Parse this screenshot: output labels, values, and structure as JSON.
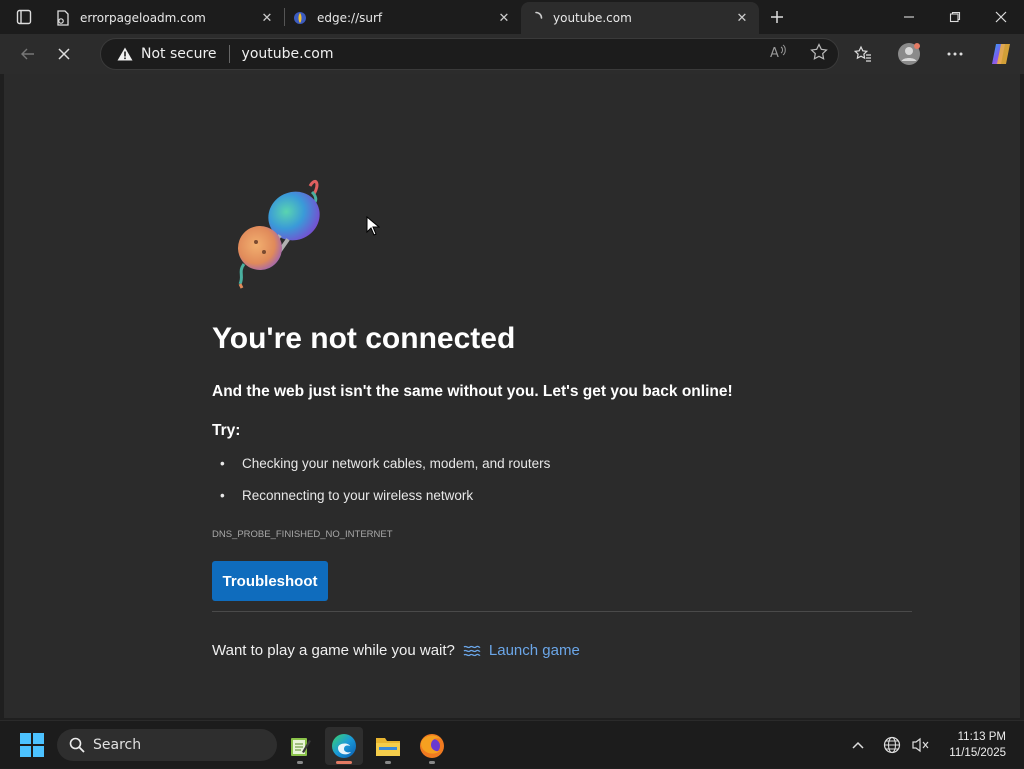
{
  "tabs": [
    {
      "title": "errorpageloadm.com",
      "icon": "document-icon"
    },
    {
      "title": "edge://surf",
      "icon": "surf-icon"
    },
    {
      "title": "youtube.com",
      "icon": "loading-spinner-icon",
      "active": true
    }
  ],
  "address_bar": {
    "security_label": "Not secure",
    "url": "youtube.com"
  },
  "error_page": {
    "title": "You're not connected",
    "subtitle": "And the web just isn't the same without you. Let's get you back online!",
    "try_label": "Try:",
    "suggestions": [
      "Checking your network cables, modem, and routers",
      "Reconnecting to your wireless network"
    ],
    "error_code": "DNS_PROBE_FINISHED_NO_INTERNET",
    "troubleshoot_label": "Troubleshoot",
    "game_prompt": "Want to play a game while you wait?",
    "game_link": "Launch game"
  },
  "taskbar": {
    "search_label": "Search",
    "time": "11:13 PM",
    "date": "11/15/2025"
  },
  "colors": {
    "accent_button": "#0f6cbd",
    "link": "#6ba6e8",
    "content_bg": "#2b2b2b"
  }
}
